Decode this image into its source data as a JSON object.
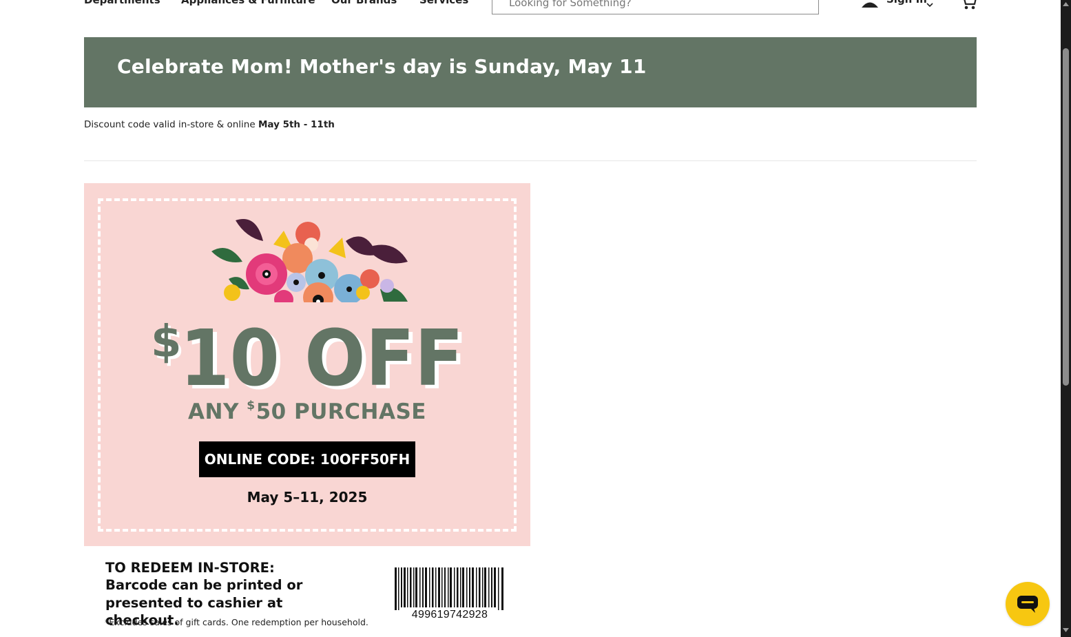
{
  "nav": {
    "items": [
      "Departments",
      "Appliances & Furniture",
      "Our Brands",
      "Services"
    ],
    "search_placeholder": "Looking for Something?",
    "sign_in_label": "Sign In",
    "icons": [
      "search-icon",
      "person-icon",
      "chevron-down-icon",
      "cart-icon"
    ]
  },
  "banner": {
    "title": "Celebrate Mom! Mother's day is Sunday, May 11"
  },
  "discount": {
    "text": "Discount code valid in-store & online ",
    "dates": "May 5th - 11th"
  },
  "coupon": {
    "amount": "10 OFF",
    "currency": "$",
    "any_prefix": "ANY ",
    "any_amount": "50 PURCHASE",
    "online_code": "ONLINE CODE: 10OFF50FH",
    "dates": "May 5–11, 2025",
    "colors": {
      "background": "#f9d6d3",
      "accent": "#637565"
    }
  },
  "redeem": {
    "title": "TO REDEEM IN-STORE:",
    "body": "Barcode can be printed or presented to cashier at checkout.",
    "excludes": "*Excludes sales of gift cards. One redemption per household.",
    "barcode_number": "499619742928"
  },
  "chat": {
    "icon": "chat-icon",
    "color": "#f7c711"
  }
}
